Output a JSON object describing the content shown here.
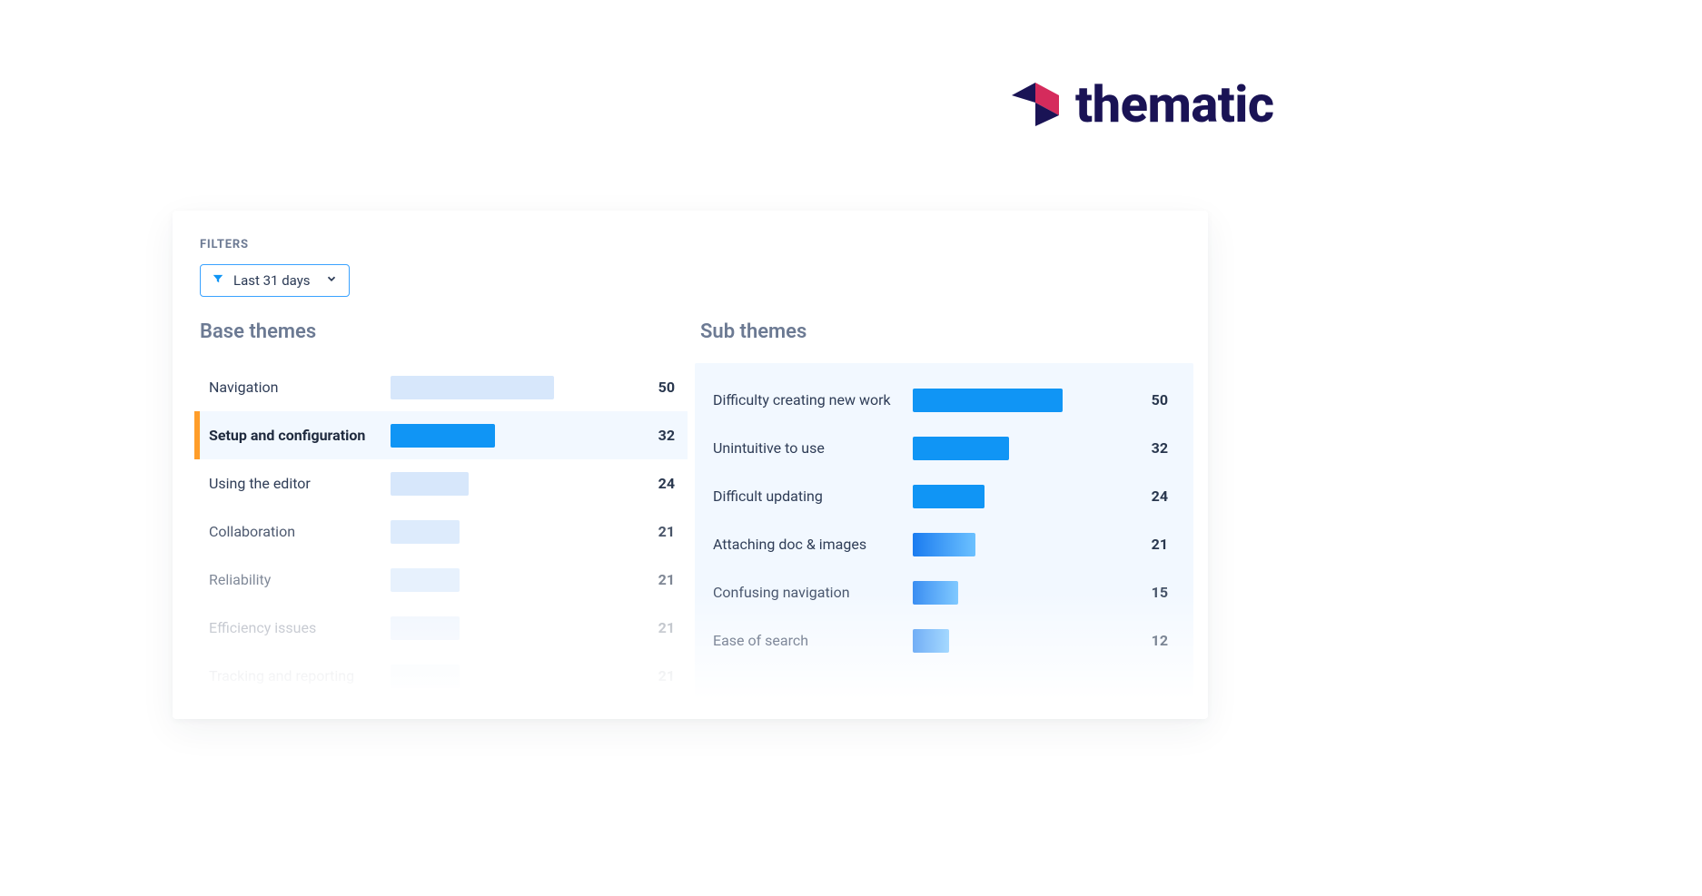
{
  "brand": {
    "name": "thematic"
  },
  "filters": {
    "label": "FILTERS",
    "selected": "Last 31 days"
  },
  "base": {
    "title": "Base themes",
    "max": 50,
    "items": [
      {
        "label": "Navigation",
        "value": 50,
        "selected": false
      },
      {
        "label": "Setup and configuration",
        "value": 32,
        "selected": true
      },
      {
        "label": "Using the editor",
        "value": 24,
        "selected": false
      },
      {
        "label": "Collaboration",
        "value": 21,
        "selected": false
      },
      {
        "label": "Reliability",
        "value": 21,
        "selected": false
      },
      {
        "label": "Efficiency issues",
        "value": 21,
        "selected": false
      },
      {
        "label": "Tracking and reporting",
        "value": 21,
        "selected": false
      }
    ]
  },
  "sub": {
    "title": "Sub themes",
    "max": 50,
    "items": [
      {
        "label": "Difficulty creating new work",
        "value": 50
      },
      {
        "label": "Unintuitive to use",
        "value": 32
      },
      {
        "label": "Difficult updating",
        "value": 24
      },
      {
        "label": "Attaching doc & images",
        "value": 21
      },
      {
        "label": "Confusing navigation",
        "value": 15
      },
      {
        "label": "Ease of search",
        "value": 12
      }
    ]
  },
  "chart_data": [
    {
      "type": "bar",
      "title": "Base themes",
      "orientation": "horizontal",
      "categories": [
        "Navigation",
        "Setup and configuration",
        "Using the editor",
        "Collaboration",
        "Reliability",
        "Efficiency issues",
        "Tracking and reporting"
      ],
      "values": [
        50,
        32,
        24,
        21,
        21,
        21,
        21
      ],
      "xlim": [
        0,
        50
      ]
    },
    {
      "type": "bar",
      "title": "Sub themes",
      "orientation": "horizontal",
      "categories": [
        "Difficulty creating new work",
        "Unintuitive to use",
        "Difficult updating",
        "Attaching doc & images",
        "Confusing navigation",
        "Ease of search"
      ],
      "values": [
        50,
        32,
        24,
        21,
        15,
        12
      ],
      "xlim": [
        0,
        50
      ]
    }
  ]
}
